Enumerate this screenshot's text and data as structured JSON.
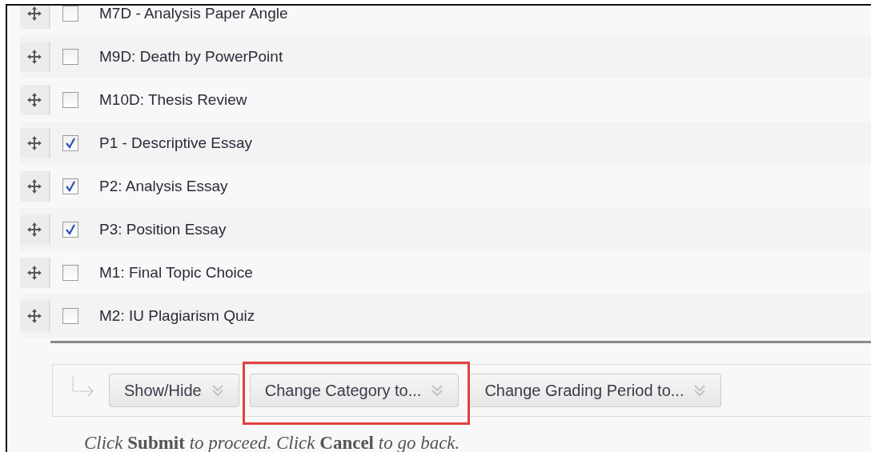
{
  "items": [
    {
      "label": "M7D - Analysis Paper Angle",
      "checked": false
    },
    {
      "label": "M9D: Death by PowerPoint",
      "checked": false
    },
    {
      "label": "M10D: Thesis Review",
      "checked": false
    },
    {
      "label": "P1 - Descriptive Essay",
      "checked": true
    },
    {
      "label": "P2: Analysis Essay",
      "checked": true
    },
    {
      "label": "P3: Position Essay",
      "checked": true
    },
    {
      "label": "M1: Final Topic Choice",
      "checked": false
    },
    {
      "label": "M2: IU Plagiarism Quiz",
      "checked": false
    }
  ],
  "actions": [
    {
      "label": "Show/Hide",
      "highlighted": false
    },
    {
      "label": "Change Category to...",
      "highlighted": true
    },
    {
      "label": "Change Grading Period to...",
      "highlighted": false
    }
  ],
  "footer": "Click **Submit** to proceed. Click **Cancel** to go back."
}
